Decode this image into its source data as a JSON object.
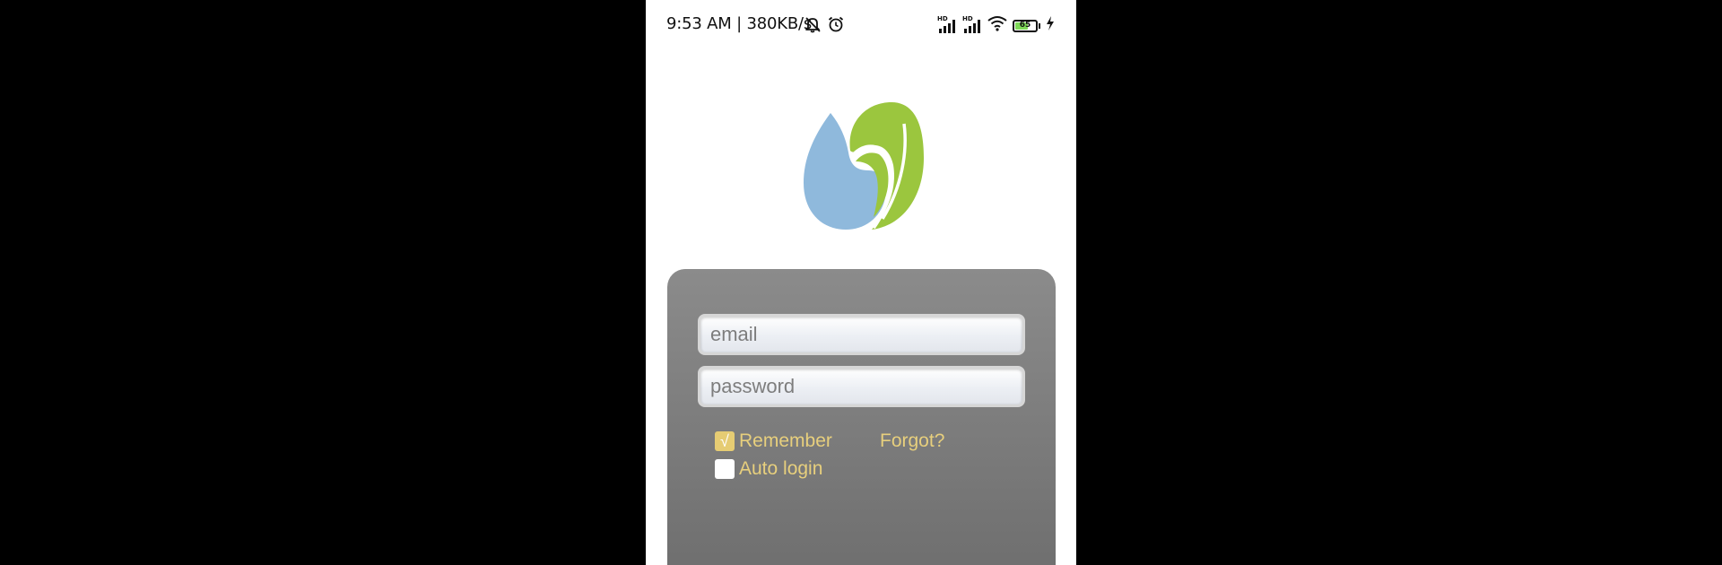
{
  "status_bar": {
    "time": "9:53 AM | 380KB/s",
    "signal_label_1": "HD",
    "signal_label_2": "HD",
    "battery_level": "65",
    "battery_fraction": 0.65,
    "icons": [
      "mute-icon",
      "alarm-icon",
      "signal-icon",
      "signal-icon",
      "wifi-icon",
      "battery-icon",
      "charging-icon"
    ]
  },
  "logo": {
    "colors": {
      "drop": "#8fb9dc",
      "leaf": "#9bc63e"
    }
  },
  "login": {
    "email_placeholder": "email",
    "password_placeholder": "password",
    "remember_label": "Remember",
    "remember_checked": true,
    "check_mark": "√",
    "forgot_label": "Forgot?",
    "auto_login_label": "Auto login",
    "auto_login_checked": false
  },
  "colors": {
    "accent_text": "#e7cf7d",
    "card_top": "#8b8b8b",
    "card_bottom": "#6d6d6d"
  }
}
